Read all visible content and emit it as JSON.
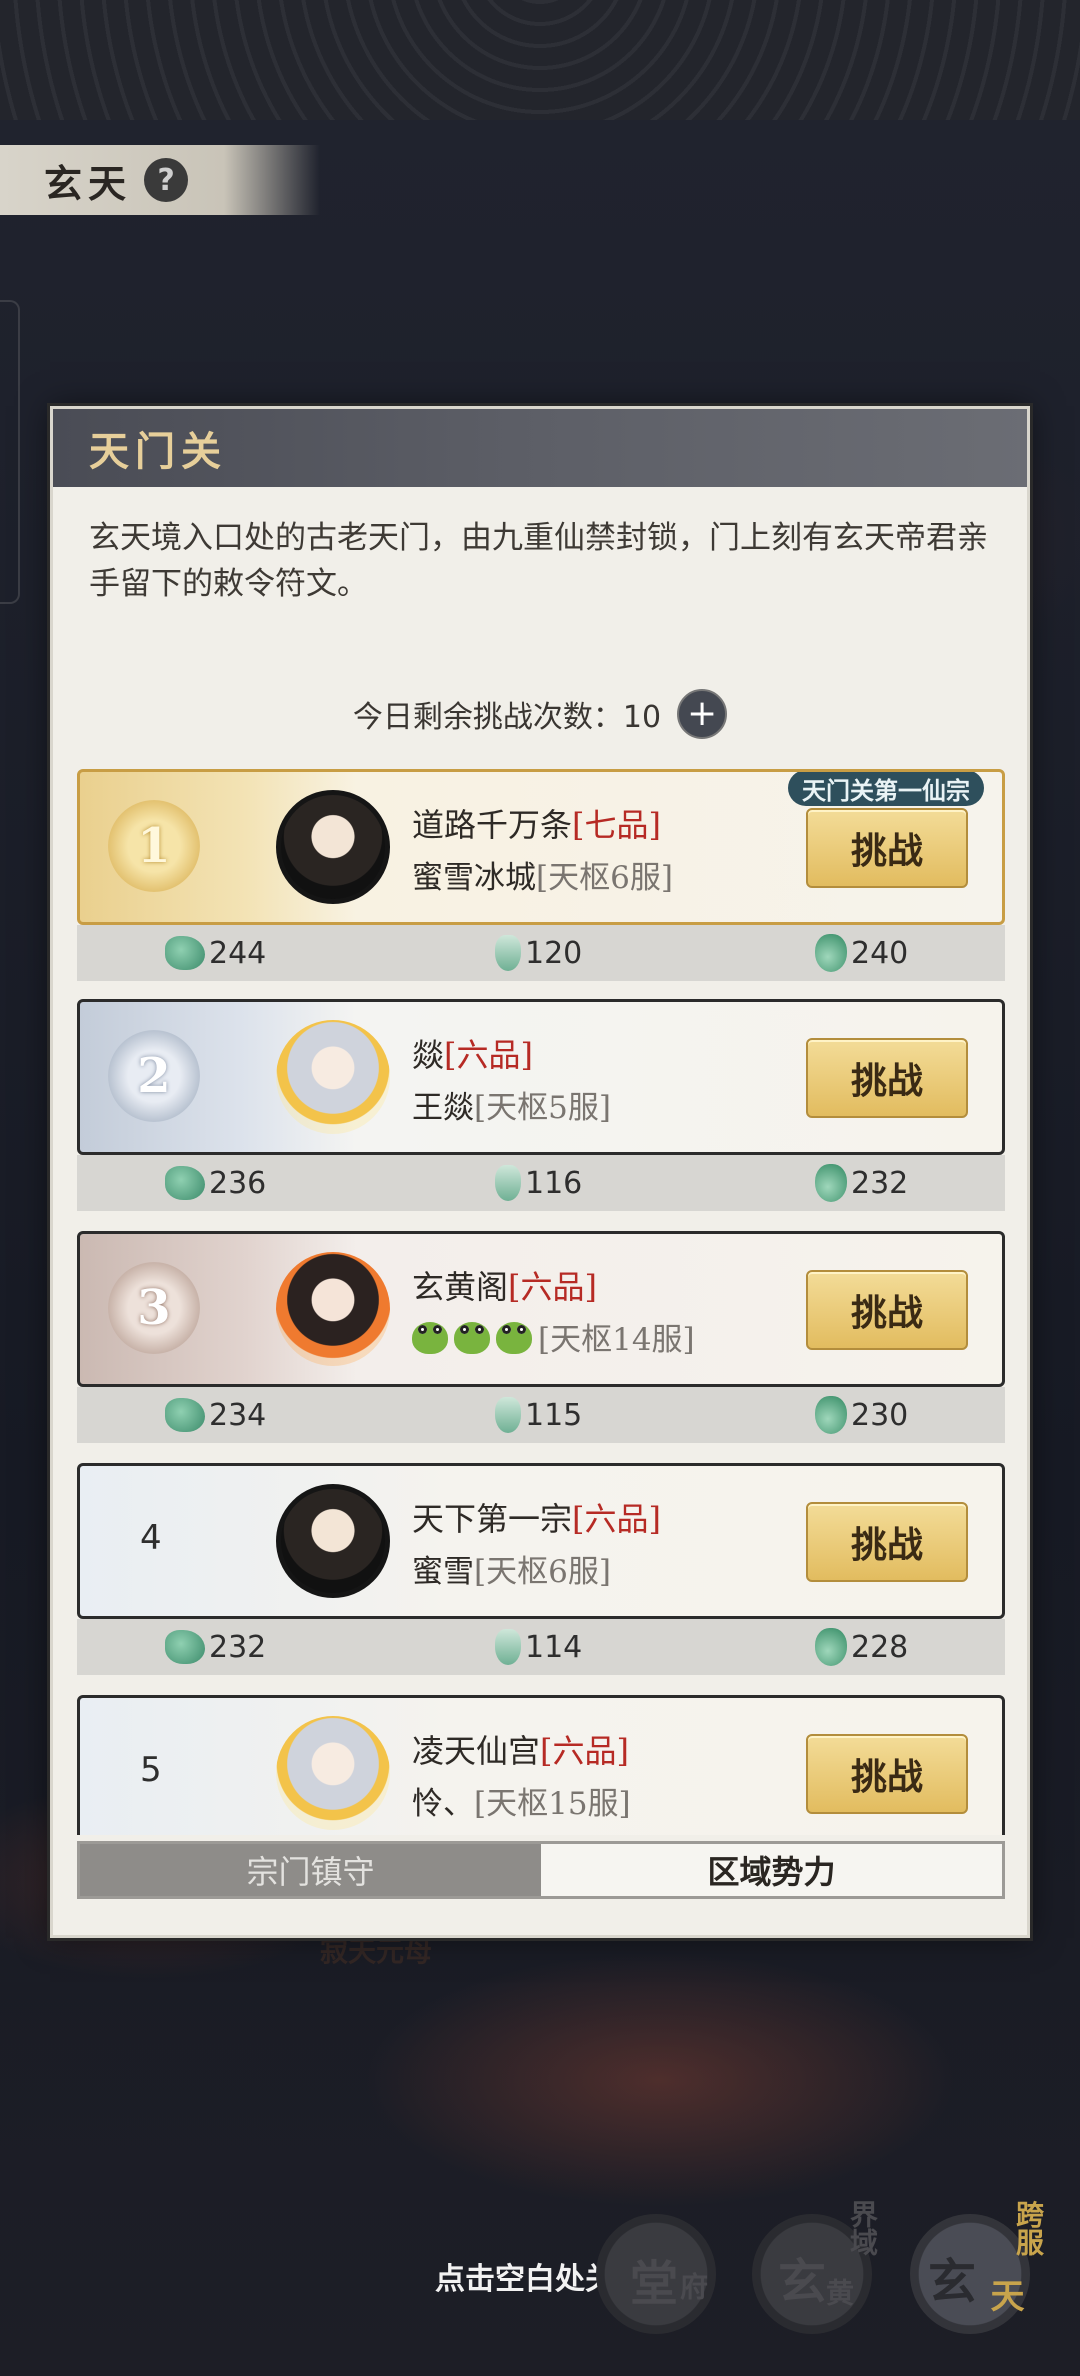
{
  "region": {
    "title": "玄天",
    "help": "?"
  },
  "map": {
    "label": "寂天元母"
  },
  "panel": {
    "title": "天门关",
    "description": "玄天境入口处的古老天门，由九重仙禁封锁，门上刻有玄天帝君亲手留下的敕令符文。",
    "attempts_label": "今日剩余挑战次数：",
    "attempts_value": "10",
    "plus": "+"
  },
  "rows": [
    {
      "rank": "1",
      "guild": "道路千万条",
      "grade": "[七品]",
      "player": "蜜雪冰城",
      "server": "[天枢6服]",
      "badge": "天门关第一仙宗",
      "button": "挑战",
      "stat1": "244",
      "stat2": "120",
      "stat3": "240"
    },
    {
      "rank": "2",
      "guild": "燚",
      "grade": "[六品]",
      "player": "王燚",
      "server": "[天枢5服]",
      "button": "挑战",
      "stat1": "236",
      "stat2": "116",
      "stat3": "232"
    },
    {
      "rank": "3",
      "guild": "玄黄阁",
      "grade": "[六品]",
      "player": "",
      "server": "[天枢14服]",
      "button": "挑战",
      "stat1": "234",
      "stat2": "115",
      "stat3": "230"
    },
    {
      "rank": "4",
      "guild": "天下第一宗",
      "grade": "[六品]",
      "player": "蜜雪",
      "server": "[天枢6服]",
      "button": "挑战",
      "stat1": "232",
      "stat2": "114",
      "stat3": "228"
    },
    {
      "rank": "5",
      "guild": "凌天仙宫",
      "grade": "[六品]",
      "player": "怜、",
      "server": "[天枢15服]",
      "button": "挑战"
    }
  ],
  "tabs": {
    "left": "宗门镇守",
    "right": "区域势力"
  },
  "footer": {
    "close_hint": "点击空白处关闭"
  },
  "nav": {
    "b1_big": "堂",
    "b1_small": "府",
    "b2_big": "玄",
    "b2_small": "界域",
    "b2_sub": "黄",
    "b3_big": "玄",
    "b3_small": "跨服",
    "b3_sub": "天"
  }
}
